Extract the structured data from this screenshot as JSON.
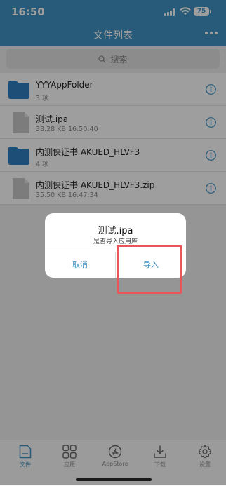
{
  "status_bar": {
    "time": "16:50",
    "battery": "75"
  },
  "header": {
    "title": "文件列表"
  },
  "search": {
    "placeholder": "搜索"
  },
  "files": [
    {
      "name": "YYYAppFolder",
      "meta": "3 项",
      "type": "folder"
    },
    {
      "name": "测试.ipa",
      "meta": "33.28 KB  16:50:40",
      "type": "file"
    },
    {
      "name": "内测侠证书 AKUED_HLVF3",
      "meta": "4 项",
      "type": "folder"
    },
    {
      "name": "内测侠证书 AKUED_HLVF3.zip",
      "meta": "35.50 KB  16:47:34",
      "type": "file"
    }
  ],
  "dialog": {
    "title": "测试.ipa",
    "message": "是否导入应用库",
    "cancel": "取消",
    "confirm": "导入"
  },
  "tabs": [
    {
      "label": "文件",
      "icon": "file-tab-icon",
      "active": true
    },
    {
      "label": "应用",
      "icon": "apps-grid-icon",
      "active": false
    },
    {
      "label": "AppStore",
      "icon": "appstore-icon",
      "active": false
    },
    {
      "label": "下载",
      "icon": "download-icon",
      "active": false
    },
    {
      "label": "设置",
      "icon": "gear-icon",
      "active": false
    }
  ],
  "colors": {
    "accent": "#3f93c4",
    "folder": "#2f7fc0",
    "file": "#c8c8c8",
    "highlight": "#e8555c"
  }
}
